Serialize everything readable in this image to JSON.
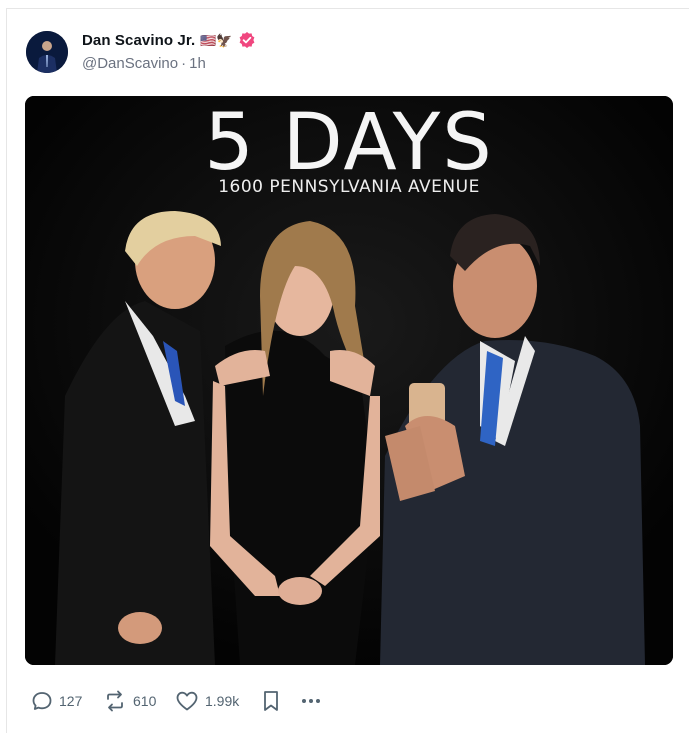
{
  "author": {
    "display_name": "Dan Scavino Jr.",
    "emojis": "🇺🇸🦅",
    "handle": "@DanScavino",
    "separator": "·",
    "time_ago": "1h",
    "verified": true,
    "verified_color": "#f0477f"
  },
  "media": {
    "headline": "5 DAYS",
    "subhead": "1600 PENNSYLVANIA AVENUE"
  },
  "actions": {
    "reply_count": "127",
    "repost_count": "610",
    "like_count": "1.99k"
  },
  "colors": {
    "icon_gray": "#536471",
    "border": "#e6e6e6"
  }
}
